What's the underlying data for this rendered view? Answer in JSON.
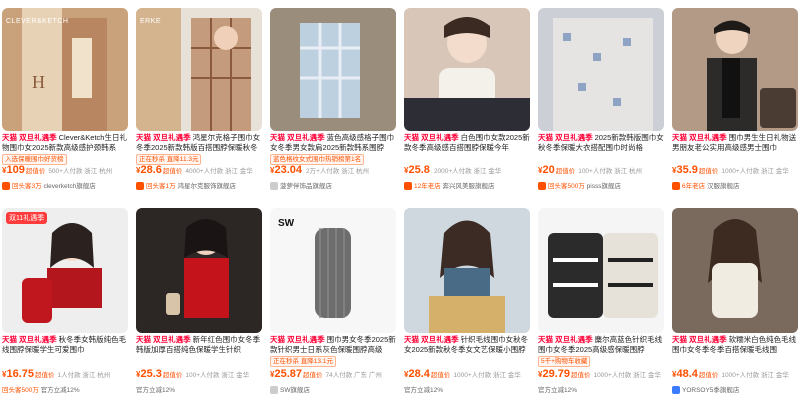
{
  "prefix": "天猫 双旦礼遇季",
  "row1": [
    {
      "title": "Clever&Ketch生日礼物围巾女2025新款高级感护颈韩系",
      "tag": "入选保暖围巾好货榜",
      "price": "109",
      "price_label": "超值价",
      "sold": "500+人付款",
      "loc": "浙江 杭州",
      "shop": "cleverketch旗舰店",
      "shop_prefix": "回头客3万",
      "logo": "CLEVER&KETCH"
    },
    {
      "title": "鸿星尔克格子围巾女冬季2025新款韩版百搭围脖保暖秋冬",
      "tag": "正在秒杀 直降11.3元",
      "price": "28.6",
      "price_label": "超值价",
      "sold": "4000+人付款",
      "loc": "浙江 金华",
      "shop": "鸿星尔克服饰旗舰店",
      "shop_prefix": "回头客1万",
      "logo": "ERKE"
    },
    {
      "title": "蓝色高级感格子围巾女冬季男女款肩2025新款韩系围脖",
      "tag": "蓝色格纹女式围巾热销榜第1名",
      "price": "23.04",
      "price_label": "",
      "sold": "2万+人付款",
      "loc": "浙江 杭州",
      "shop": "菠萝伴饰品旗舰店",
      "shop_prefix": "",
      "logo": ""
    },
    {
      "title": "白色围巾女款2025新款冬季高级感百搭围脖保暖今年",
      "tag": "",
      "price": "25.8",
      "price_label": "",
      "sold": "2000+人付款",
      "loc": "浙江 金华",
      "shop": "奔兴风美服旗舰店",
      "shop_prefix": "12年老店",
      "logo": ""
    },
    {
      "title": "2025新款韩版围巾女秋冬季保暖大衣搭配围巾时尚格",
      "tag": "",
      "price": "20",
      "price_label": "超值价",
      "sold": "100+人付款",
      "loc": "浙江 杭州",
      "shop": "pisss旗舰店",
      "shop_prefix": "回头客500万",
      "logo": ""
    },
    {
      "title": "围巾男生生日礼物送男朋友老公实用高级感男士围巾",
      "tag": "",
      "price": "35.9",
      "price_label": "超值价",
      "sold": "1000+人付款",
      "loc": "浙江 金华",
      "shop": "汉服旗舰店",
      "shop_prefix": "6年老店",
      "logo": ""
    }
  ],
  "row2": [
    {
      "title": "秋冬季女韩版纯色毛线围脖保暖学生可爱围巾",
      "tag": "",
      "price": "16.75",
      "price_label": "超值价",
      "sold": "1人付款",
      "loc": "浙江 杭州",
      "shop": "官方立减12%",
      "shop_prefix": "回头客500万",
      "badge": "双11礼遇季"
    },
    {
      "title": "新年红色围巾女冬季韩版加厚百搭纯色保暖学生针织",
      "tag": "",
      "price": "25.3",
      "price_label": "超值价",
      "sold": "100+人付款",
      "loc": "浙江 金华",
      "shop": "官方立减12%",
      "shop_prefix": "",
      "badge": ""
    },
    {
      "title": "围巾男女冬季2025新款针织男士日系灰色保暖围脖高级",
      "tag": "正在秒杀 直降13.1元",
      "price": "25.87",
      "price_label": "超值价",
      "sold": "74人付款",
      "loc": "广东 广州",
      "shop": "SW旗舰店",
      "shop_prefix": "",
      "badge": ""
    },
    {
      "title": "针织毛线围巾女秋冬女2025新款秋冬季女文艺保暖小围脖",
      "tag": "",
      "price": "28.4",
      "price_label": "超值价",
      "sold": "1000+人付款",
      "loc": "浙江 金华",
      "shop": "官方立减12%",
      "shop_prefix": "",
      "badge": ""
    },
    {
      "title": "麋尔高蓝色针织毛线围巾女冬季2025高级感保暖围脖",
      "tag": "5千+购物车收藏",
      "price": "29.79",
      "price_label": "超值价",
      "sold": "1000+人付款",
      "loc": "浙江 金华",
      "shop": "官方立减12%",
      "shop_prefix": "",
      "badge": ""
    },
    {
      "title": "软糯米白色纯色毛线围巾女冬季冬季百搭保暖毛线围",
      "tag": "",
      "price": "48.4",
      "price_label": "超值价",
      "sold": "1000+人付款",
      "loc": "浙江 金华",
      "shop": "YORSOY5季旗舰店",
      "shop_prefix": "",
      "badge": ""
    }
  ],
  "colors": {
    "accent": "#ff5000",
    "tmall": "#ff0036"
  }
}
